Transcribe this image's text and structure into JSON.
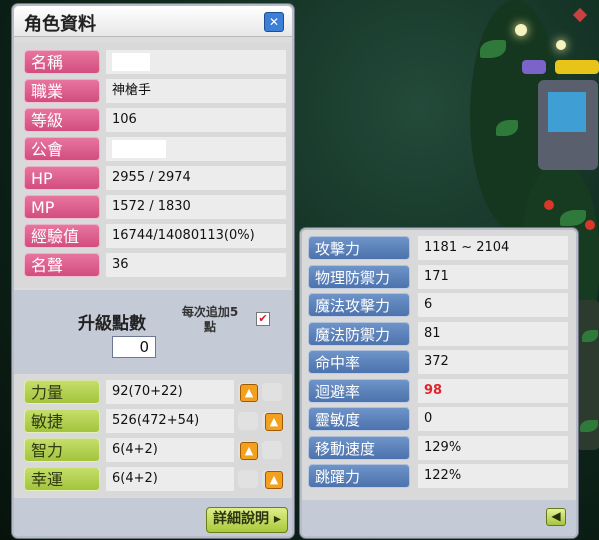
{
  "window": {
    "title": "角色資料",
    "close_icon": "close-icon"
  },
  "profile": [
    {
      "label": "名稱",
      "value": ""
    },
    {
      "label": "職業",
      "value": "神槍手"
    },
    {
      "label": "等級",
      "value": "106"
    },
    {
      "label": "公會",
      "value": ""
    },
    {
      "label": "HP",
      "value": "2955 / 2974"
    },
    {
      "label": "MP",
      "value": "1572 / 1830"
    },
    {
      "label": "經驗值",
      "value": "16744/14080113(0%)"
    },
    {
      "label": "名聲",
      "value": "36"
    }
  ],
  "ability_points": {
    "title": "升級點數",
    "value": "0",
    "per_add_label": "每次追加5\n點",
    "checked_mark": "✔"
  },
  "stats": [
    {
      "label": "力量",
      "value": "92(70+22)",
      "up": "left"
    },
    {
      "label": "敏捷",
      "value": "526(472+54)",
      "up": "right"
    },
    {
      "label": "智力",
      "value": "6(4+2)",
      "up": "left"
    },
    {
      "label": "幸運",
      "value": "6(4+2)",
      "up": "right"
    }
  ],
  "detail_button": "詳細說明",
  "detail": [
    {
      "label": "攻擊力",
      "value": "1181 ~ 2104"
    },
    {
      "label": "物理防禦力",
      "value": "171"
    },
    {
      "label": "魔法攻擊力",
      "value": "6"
    },
    {
      "label": "魔法防禦力",
      "value": "81"
    },
    {
      "label": "命中率",
      "value": "372"
    },
    {
      "label": "迴避率",
      "value": "98",
      "highlight": "#e0242d"
    },
    {
      "label": "靈敏度",
      "value": "0"
    },
    {
      "label": "移動速度",
      "value": "129%"
    },
    {
      "label": "跳躍力",
      "value": "122%"
    }
  ],
  "colors": {
    "profile_label": "#d24d7f",
    "stat_label": "#a3c43c",
    "detail_label": "#4d72ad",
    "up_button": "#f2a01e"
  },
  "icons": {
    "up": "arrow-up-icon",
    "back": "arrow-left-icon"
  }
}
